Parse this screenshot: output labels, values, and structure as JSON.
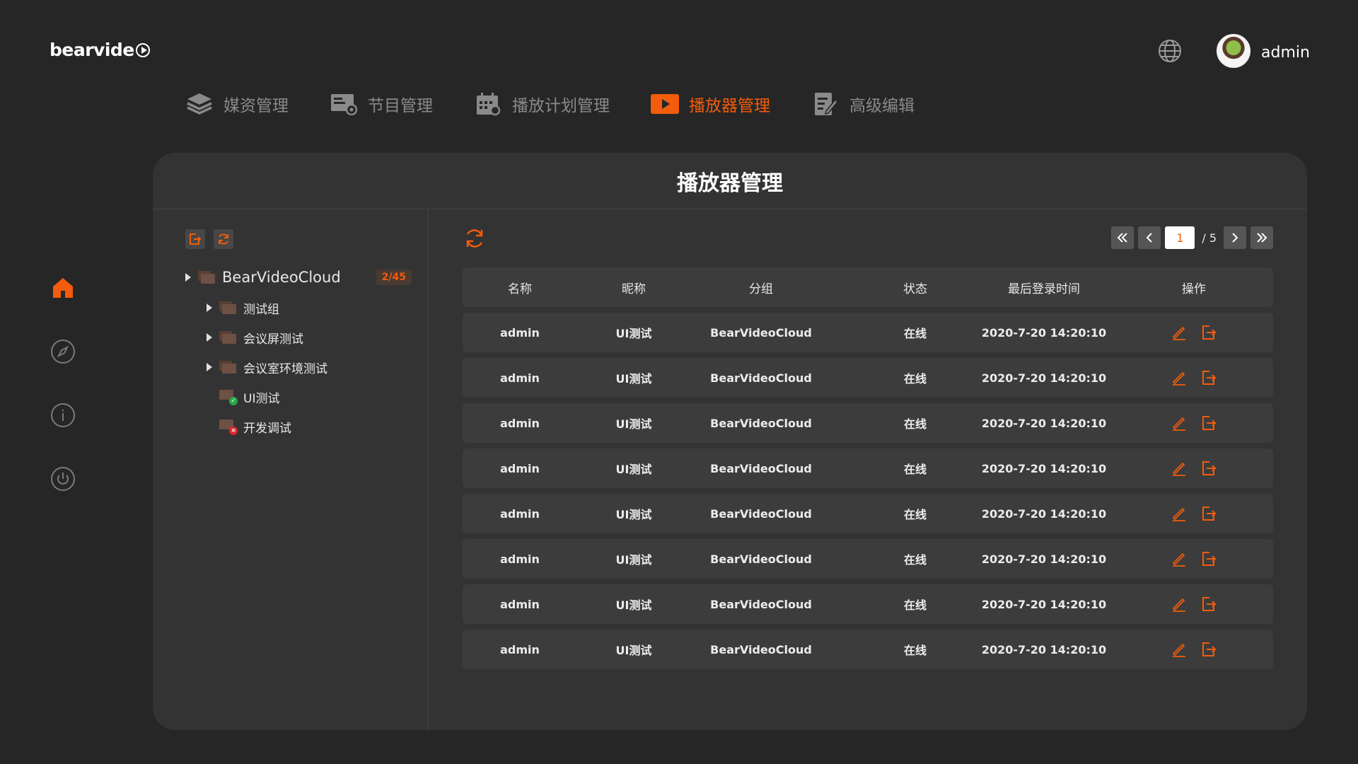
{
  "logo": {
    "text": "bearvide"
  },
  "user": {
    "name": "admin"
  },
  "nav": [
    {
      "label": "媒资管理",
      "icon": "layers-icon",
      "active": false
    },
    {
      "label": "节目管理",
      "icon": "program-icon",
      "active": false
    },
    {
      "label": "播放计划管理",
      "icon": "calendar-icon",
      "active": false
    },
    {
      "label": "播放器管理",
      "icon": "play-icon",
      "active": true
    },
    {
      "label": "高级编辑",
      "icon": "edit-doc-icon",
      "active": false
    }
  ],
  "sidebar": [
    "home-icon",
    "compass-icon",
    "info-icon",
    "power-icon"
  ],
  "colors": {
    "accent": "#f25c0c",
    "online": "#2aa84a",
    "error": "#e0242c"
  },
  "card": {
    "title": "播放器管理"
  },
  "tree": {
    "root": {
      "label": "BearVideoCloud",
      "badge": "2/45"
    },
    "groups": [
      {
        "label": "测试组"
      },
      {
        "label": "会议屏测试"
      },
      {
        "label": "会议室环境测试"
      }
    ],
    "devices": [
      {
        "label": "UI测试",
        "status": "online"
      },
      {
        "label": "开发调试",
        "status": "error"
      }
    ]
  },
  "pager": {
    "current": "1",
    "total": "/ 5"
  },
  "table": {
    "headers": [
      "名称",
      "昵称",
      "分组",
      "状态",
      "最后登录时间",
      "操作"
    ],
    "rows": [
      [
        "admin",
        "UI测试",
        "BearVideoCloud",
        "在线",
        "2020-7-20  14:20:10"
      ],
      [
        "admin",
        "UI测试",
        "BearVideoCloud",
        "在线",
        "2020-7-20  14:20:10"
      ],
      [
        "admin",
        "UI测试",
        "BearVideoCloud",
        "在线",
        "2020-7-20  14:20:10"
      ],
      [
        "admin",
        "UI测试",
        "BearVideoCloud",
        "在线",
        "2020-7-20  14:20:10"
      ],
      [
        "admin",
        "UI测试",
        "BearVideoCloud",
        "在线",
        "2020-7-20  14:20:10"
      ],
      [
        "admin",
        "UI测试",
        "BearVideoCloud",
        "在线",
        "2020-7-20  14:20:10"
      ],
      [
        "admin",
        "UI测试",
        "BearVideoCloud",
        "在线",
        "2020-7-20  14:20:10"
      ],
      [
        "admin",
        "UI测试",
        "BearVideoCloud",
        "在线",
        "2020-7-20  14:20:10"
      ]
    ]
  }
}
